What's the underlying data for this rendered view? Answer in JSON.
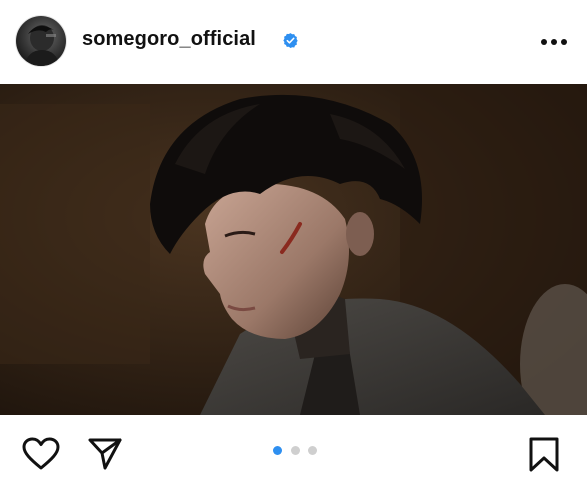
{
  "post": {
    "username": "somegoro_official",
    "verified": true,
    "colors": {
      "verified_badge": "#2e8ff0",
      "active_dot": "#2e8ff0",
      "inactive_dot": "#cfcfcf",
      "icon": "#111111"
    }
  },
  "header": {
    "avatar_icon": "profile-avatar",
    "verified_icon": "verified-badge-icon",
    "more_icon": "more-options-icon"
  },
  "media": {
    "description_icon": "photo-content",
    "carousel": {
      "count": 3,
      "active_index": 0
    }
  },
  "actions": {
    "like_icon": "heart-icon",
    "share_icon": "send-icon",
    "save_icon": "bookmark-icon"
  }
}
